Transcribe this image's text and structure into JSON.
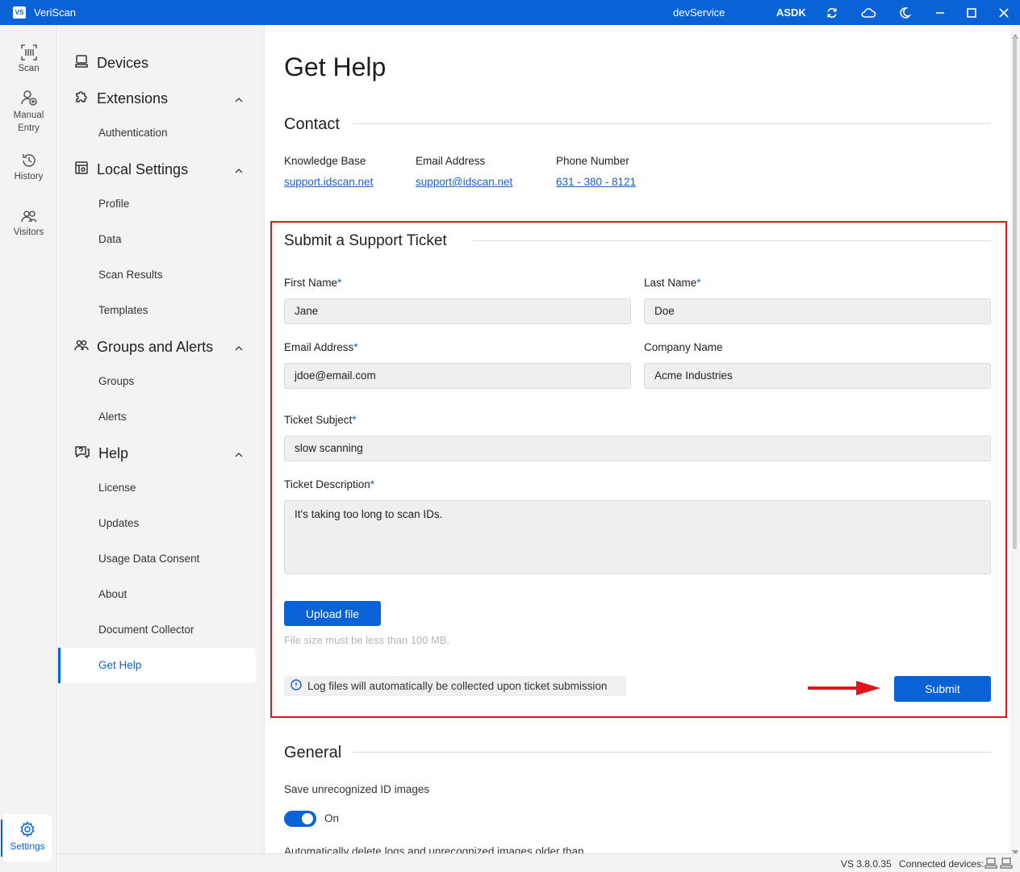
{
  "titlebar": {
    "logo": "VS",
    "app_name": "VeriScan",
    "service": "devService",
    "mode": "ASDK",
    "icons": [
      "sync-icon",
      "cloud-icon",
      "moon-icon",
      "minimize-icon",
      "maximize-icon",
      "close-icon"
    ]
  },
  "rail": {
    "items": [
      {
        "label": "Scan",
        "icon": "barcode-scan-icon"
      },
      {
        "label": "Manual Entry",
        "icon": "add-user-icon"
      },
      {
        "label": "History",
        "icon": "history-icon"
      },
      {
        "label": "Visitors",
        "icon": "visitors-icon"
      }
    ],
    "settings": {
      "label": "Settings",
      "icon": "gear-icon"
    }
  },
  "nav": {
    "devices": "Devices",
    "extensions": "Extensions",
    "authentication": "Authentication",
    "local_settings": "Local Settings",
    "profile": "Profile",
    "data": "Data",
    "scan_results": "Scan Results",
    "templates": "Templates",
    "groups_alerts": "Groups and Alerts",
    "groups": "Groups",
    "alerts": "Alerts",
    "help": "Help",
    "license": "License",
    "updates": "Updates",
    "usage_data_consent": "Usage Data Consent",
    "about": "About",
    "document_collector": "Document Collector",
    "get_help": "Get Help"
  },
  "main": {
    "page_title": "Get Help",
    "contact": {
      "title": "Contact",
      "knowledge_base_label": "Knowledge Base",
      "knowledge_base_link": "support.idscan.net",
      "email_label": "Email Address",
      "email_link": "support@idscan.net",
      "phone_label": "Phone Number",
      "phone_link": "631 - 380 - 8121"
    },
    "ticket": {
      "title": "Submit a Support Ticket",
      "required_mark": "*",
      "first_name_label": "First Name",
      "first_name_value": "Jane",
      "last_name_label": "Last Name",
      "last_name_value": "Doe",
      "email_label": "Email Address",
      "email_value": "jdoe@email.com",
      "company_label": "Company Name",
      "company_value": "Acme Industries",
      "subject_label": "Ticket Subject",
      "subject_value": "slow scanning",
      "description_label": "Ticket Description",
      "description_value": "It's taking too long to scan IDs.",
      "upload_label": "Upload file",
      "file_hint": "File size must be less than 100 MB.",
      "log_notice": "Log files will automatically be collected upon ticket submission",
      "submit_label": "Submit"
    },
    "general": {
      "title": "General",
      "save_unrecognized_label": "Save unrecognized ID images",
      "toggle_state": "On",
      "auto_delete_label": "Automatically delete logs and unrecognized images older than"
    }
  },
  "statusbar": {
    "version": "VS 3.8.0.35",
    "connected_label": "Connected devices:"
  },
  "colors": {
    "accent": "#0a63d6",
    "highlight_border": "#e5141b"
  }
}
